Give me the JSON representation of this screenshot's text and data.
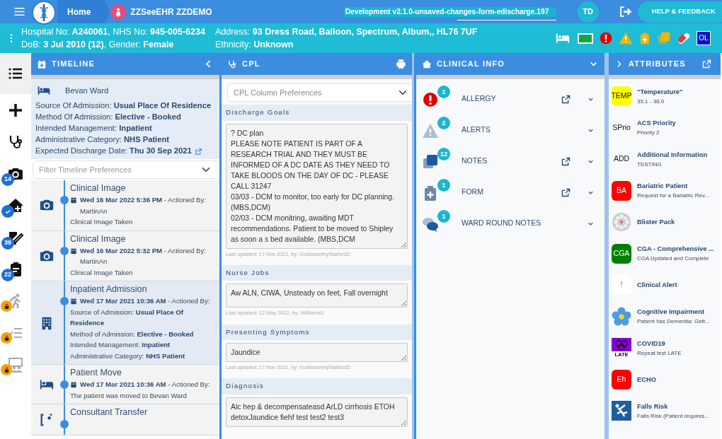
{
  "header": {
    "home": "Home",
    "patient": "ZZSeeEHR ZZDEMO",
    "version": "Development v2.1.0-unsaved-changes-form-edischarge.197",
    "user": "TD",
    "help": "HELP & FEEDBACK"
  },
  "patient_bar": {
    "left": [
      "Hospital No: **A240061**, NHS No: **945-005-6234**",
      "DoB: **3 Jul 2010 (12)**, Gender: **Female**"
    ],
    "right": [
      "Address: **93 Dress Road, Balloon, Spectrum, Album,, HL76 7UF**",
      "Ethnicity: **Unknown**"
    ],
    "badge": "OL"
  },
  "sidebar": [
    {
      "kind": "plain",
      "selected": true
    },
    {
      "kind": "plain",
      "selected": false
    },
    {
      "kind": "plain",
      "selected": false
    },
    {
      "kind": "count",
      "badge": "14",
      "selected": false
    },
    {
      "kind": "done",
      "selected": false
    },
    {
      "kind": "count",
      "badge": "39",
      "selected": false
    },
    {
      "kind": "count",
      "badge": "22",
      "selected": false
    },
    {
      "kind": "locked",
      "selected": false
    },
    {
      "kind": "locked",
      "selected": false
    },
    {
      "kind": "locked",
      "selected": false
    }
  ],
  "timeline": {
    "title": "TIMELINE",
    "summary": {
      "ward": "Bevan Ward",
      "lines": [
        "Source Of Admission: **Usual Place Of Residence**",
        "Method Of Admission: **Elective - Booked**",
        "Intended Management: **Inpatient**",
        "Administrative Category: **NHS Patient**",
        "Expected Discharge Date: **Thu 30 Sep 2021**"
      ]
    },
    "filter_placeholder": "Filter Timeline Preferences",
    "events": [
      {
        "kind": "image",
        "title": "Clinical Image",
        "when": "**Wed 16 Mar 2022 5:36 PM** - Actioned By: MartinAn",
        "lines": [
          "Clinical Image Taken"
        ],
        "selected": false
      },
      {
        "kind": "image",
        "title": "Clinical Image",
        "when": "**Wed 16 Mar 2022 5:32 PM** - Actioned By: MartinAn",
        "lines": [
          "Clinical Image Taken"
        ],
        "selected": false
      },
      {
        "kind": "admission",
        "title": "Inpatient Admission",
        "when": "**Wed 17 Mar 2021 10:36 AM** - Actioned By:",
        "lines": [
          "Source of Admission: **Usual Place Of Residence**",
          "Method of Admission: **Elective - Booked**",
          "Intended Management: **Inpatient**",
          "Administrative Category: **NHS Patient**"
        ],
        "selected": true
      },
      {
        "kind": "move",
        "title": "Patient Move",
        "when": "**Wed 17 Mar 2021 10:36 AM** - Actioned By:",
        "lines": [
          "The patient was moved to Bevan Ward"
        ],
        "selected": false
      },
      {
        "kind": "transfer",
        "title": "Consultant Transfer",
        "selected": false
      }
    ]
  },
  "cpl": {
    "title": "CPL",
    "preferences_placeholder": "CPL Column Preferences",
    "sections": [
      {
        "heading": "Discharge Goals",
        "value": "? DC plan\nPLEASE NOTE PATIENT IS PART OF A RESEARCH TRIAL AND THEY MUST BE INFORMED OF A DC DATE AS THEY NEED TO TAKE BLOODS ON THE DAY OF DC - PLEASE CALL 31247\n03/03 - DCM to monitor, too early for DC planning. (MBS,DCM)\n02/03 - DCM monitring, awaiting MDT recommendations. Patient to be moved to Shipley as soon a s bed available. (MBS,DCM",
        "updated": "Last updated: 17 Mar 2021, by: GoldsworthySlatfordD"
      },
      {
        "heading": "Nurse Jobs",
        "value": "Aw ALN, CIWA, Unsteady on feet, Fall overnight",
        "updated": "Last updated: 12 May 2022, by: WilliamsG"
      },
      {
        "heading": "Presenting Symptoms",
        "value": "Jaundice",
        "updated": "Last updated: 17 Mar 2021, by: GoldsworthySlatfordD"
      },
      {
        "heading": "Diagnosis",
        "value": "Alc hep & decompensateasd ArLD cirrhosis ETOH detoxJaundice fiehf test test2 test3"
      }
    ]
  },
  "clinical_info": {
    "title": "CLINICAL INFO",
    "items": [
      {
        "kind": "allergy",
        "label": "ALLERGY",
        "count": "1",
        "external_link": true
      },
      {
        "kind": "alert",
        "label": "ALERTS",
        "count": "2",
        "external_link": false
      },
      {
        "kind": "notes",
        "label": "NOTES",
        "count": "12",
        "external_link": true
      },
      {
        "kind": "form",
        "label": "FORM",
        "count": "1",
        "external_link": true
      },
      {
        "kind": "ward_round",
        "label": "WARD ROUND NOTES",
        "count": "1",
        "external_link": false
      }
    ]
  },
  "attributes": {
    "title": "ATTRIBUTES",
    "items": [
      {
        "kind": "text",
        "badge": "TEMP",
        "color": "#ffff00",
        "name": "\"Temperature\"",
        "detail": "35.1 - 36.0"
      },
      {
        "kind": "text",
        "badge": "SPrio",
        "name": "ACS Priority",
        "detail": "Priority 2"
      },
      {
        "kind": "text",
        "badge": "ADD",
        "name": "Additional Information",
        "detail": "TESTING"
      },
      {
        "kind": "text",
        "badge": "BA",
        "color": "#ff0000",
        "name": "Bariatric Patient",
        "detail": "Request for a Bariatric Rev..."
      },
      {
        "kind": "blister",
        "name": "Blister Pack"
      },
      {
        "kind": "text",
        "badge": "CGA",
        "color": "#008000",
        "name": "CGA - Comprehensive ...",
        "detail": "CGA Updated and Complete"
      },
      {
        "kind": "text",
        "badge": "!",
        "color": "#ffffff",
        "name": "Clinical Alert"
      },
      {
        "kind": "flower",
        "name": "Cognitive Impairment",
        "detail": "Patient has Dementia: Gett..."
      },
      {
        "kind": "covid",
        "badge": "LATE",
        "name": "COVID19",
        "detail": "Repeat test LATE"
      },
      {
        "kind": "text",
        "badge": "Eh",
        "color": "#ff0000",
        "name": "ECHO"
      },
      {
        "kind": "falls",
        "name": "Falls Risk",
        "detail": "Falls Risk (Patient requires..."
      }
    ]
  }
}
